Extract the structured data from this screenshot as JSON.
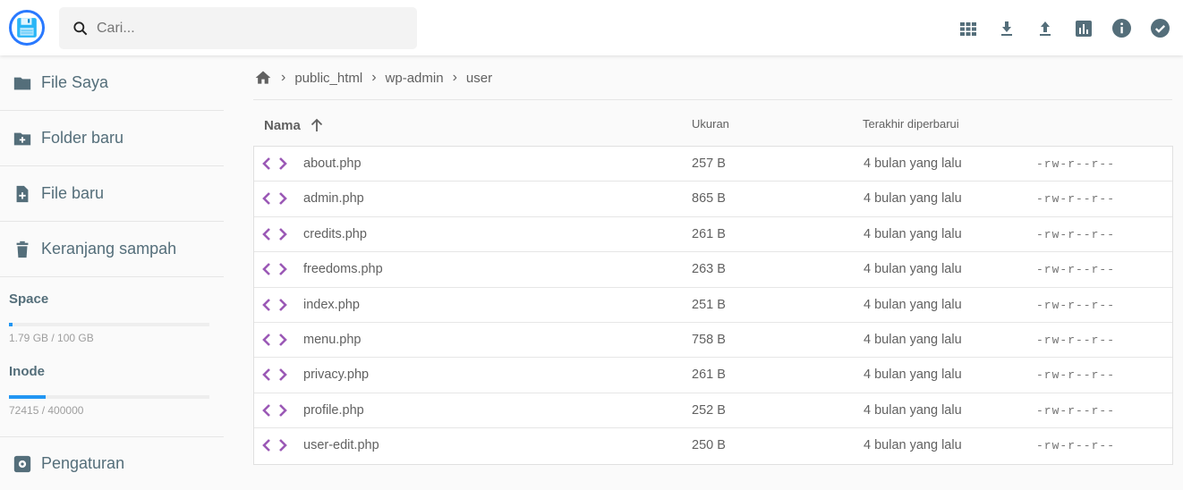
{
  "search": {
    "placeholder": "Cari..."
  },
  "toolbar": [
    "grid-view-icon",
    "download-icon",
    "upload-icon",
    "chart-icon",
    "info-icon",
    "check-circle-icon"
  ],
  "sidebar": {
    "items": [
      {
        "label": "File Saya"
      },
      {
        "label": "Folder baru"
      },
      {
        "label": "File baru"
      },
      {
        "label": "Keranjang sampah"
      }
    ],
    "space": {
      "title": "Space",
      "text": "1.79 GB / 100 GB",
      "percent": 1.79
    },
    "inode": {
      "title": "Inode",
      "text": "72415 / 400000",
      "percent": 18.1
    },
    "settings": "Pengaturan"
  },
  "breadcrumb": [
    "public_html",
    "wp-admin",
    "user"
  ],
  "table": {
    "headers": {
      "name": "Nama",
      "size": "Ukuran",
      "modified": "Terakhir diperbarui"
    },
    "rows": [
      {
        "name": "about.php",
        "size": "257 B",
        "modified": "4 bulan yang lalu",
        "perm": "-rw-r--r--"
      },
      {
        "name": "admin.php",
        "size": "865 B",
        "modified": "4 bulan yang lalu",
        "perm": "-rw-r--r--"
      },
      {
        "name": "credits.php",
        "size": "261 B",
        "modified": "4 bulan yang lalu",
        "perm": "-rw-r--r--"
      },
      {
        "name": "freedoms.php",
        "size": "263 B",
        "modified": "4 bulan yang lalu",
        "perm": "-rw-r--r--"
      },
      {
        "name": "index.php",
        "size": "251 B",
        "modified": "4 bulan yang lalu",
        "perm": "-rw-r--r--"
      },
      {
        "name": "menu.php",
        "size": "758 B",
        "modified": "4 bulan yang lalu",
        "perm": "-rw-r--r--"
      },
      {
        "name": "privacy.php",
        "size": "261 B",
        "modified": "4 bulan yang lalu",
        "perm": "-rw-r--r--"
      },
      {
        "name": "profile.php",
        "size": "252 B",
        "modified": "4 bulan yang lalu",
        "perm": "-rw-r--r--"
      },
      {
        "name": "user-edit.php",
        "size": "250 B",
        "modified": "4 bulan yang lalu",
        "perm": "-rw-r--r--"
      }
    ]
  },
  "colors": {
    "accent": "#2196f3",
    "icon": "#546e7a",
    "code": "#9b59b6"
  }
}
